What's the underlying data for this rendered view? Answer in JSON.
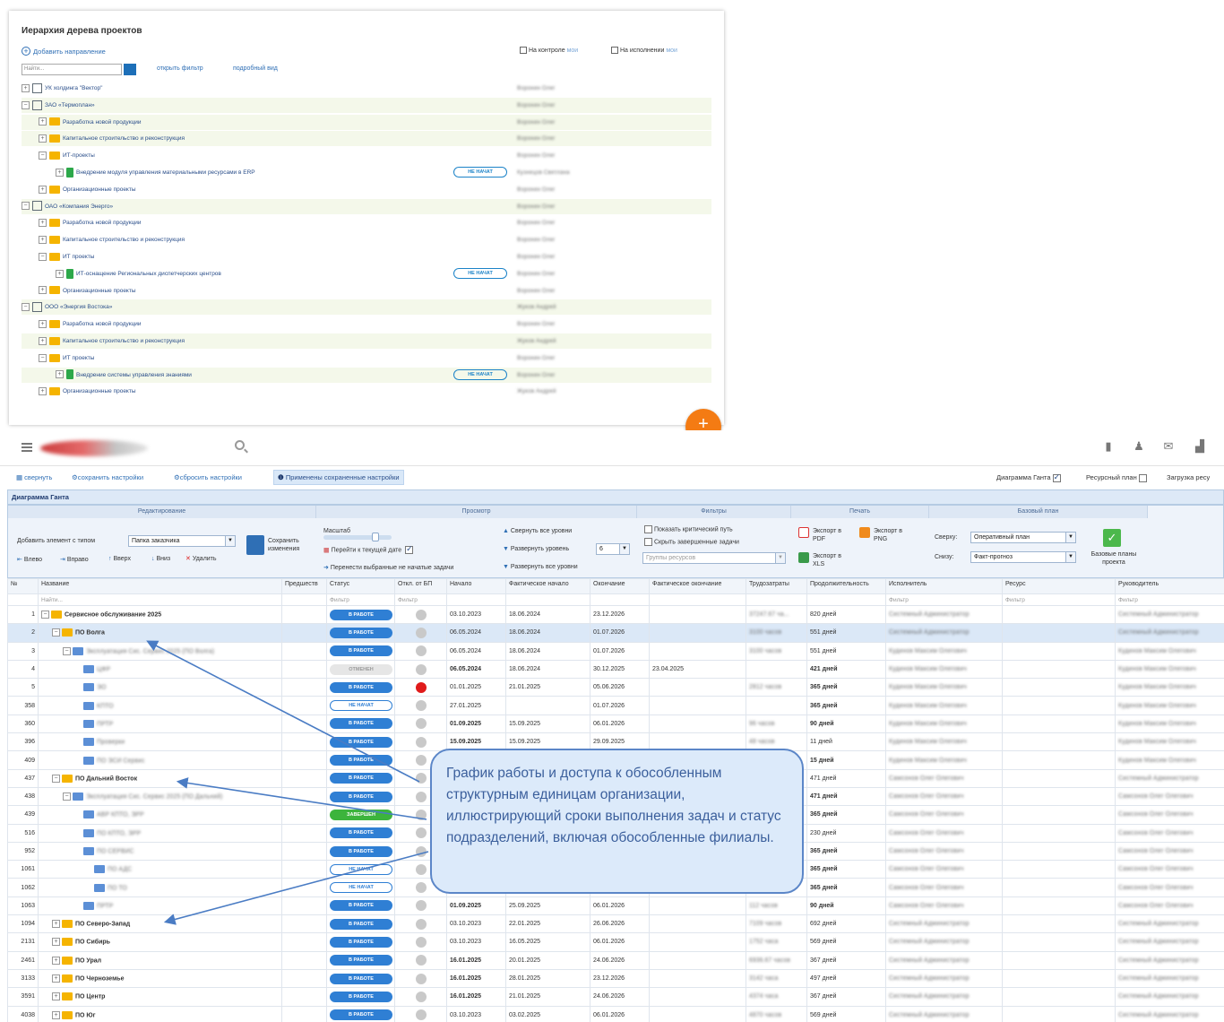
{
  "top_panel": {
    "title": "Иерархия дерева проектов",
    "add_direction": "Добавить направление",
    "search_placeholder": "Найти...",
    "open_filter": "открыть фильтр",
    "detail_view": "подробный вид",
    "on_control_label": "На контроле",
    "on_execution_label": "На исполнении",
    "mine_label": "мои",
    "not_started": "НЕ НАЧАТ",
    "fab_plus": "+",
    "tree": [
      {
        "level": 0,
        "icon": "building",
        "name": "УК холдинга \"Вектор\"",
        "resp": "Воронин Олег",
        "band": false,
        "expander": "+"
      },
      {
        "level": 0,
        "icon": "building",
        "name": "ЗАО «Термоплан»",
        "resp": "Воронин Олег",
        "band": true,
        "expander": "−"
      },
      {
        "level": 1,
        "icon": "folder",
        "name": "Разработка новой продукции",
        "resp": "Воронин Олег",
        "band": true,
        "expander": "+"
      },
      {
        "level": 1,
        "icon": "folder",
        "name": "Капитальное строительство и реконструкция",
        "resp": "Воронин Олег",
        "band": true,
        "expander": "+"
      },
      {
        "level": 1,
        "icon": "folder",
        "name": "ИТ-проекты",
        "resp": "Воронин Олег",
        "band": false,
        "expander": "−"
      },
      {
        "level": 2,
        "icon": "green",
        "name": "Внедрение модуля управления материальными ресурсами в ERP",
        "resp": "Кузнецов Светлана",
        "band": false,
        "expander": "+",
        "badge": true
      },
      {
        "level": 1,
        "icon": "folder",
        "name": "Организационные проекты",
        "resp": "Воронин Олег",
        "band": false,
        "expander": "+"
      },
      {
        "level": 0,
        "icon": "building",
        "name": "ОАО «Компания Энерго»",
        "resp": "Воронин Олег",
        "band": true,
        "expander": "−"
      },
      {
        "level": 1,
        "icon": "folder",
        "name": "Разработка новой продукции",
        "resp": "Воронин Олег",
        "band": false,
        "expander": "+"
      },
      {
        "level": 1,
        "icon": "folder",
        "name": "Капитальное строительство и реконструкция",
        "resp": "Воронин Олег",
        "band": false,
        "expander": "+"
      },
      {
        "level": 1,
        "icon": "folder",
        "name": "ИТ проекты",
        "resp": "Воронин Олег",
        "band": false,
        "expander": "−"
      },
      {
        "level": 2,
        "icon": "green",
        "name": "ИТ-оснащение Региональных диспетчерских центров",
        "resp": "Воронин Олег",
        "band": false,
        "expander": "+",
        "badge": true
      },
      {
        "level": 1,
        "icon": "folder",
        "name": "Организационные проекты",
        "resp": "Воронин Олег",
        "band": false,
        "expander": "+"
      },
      {
        "level": 0,
        "icon": "building",
        "name": "ООО «Энергия Востока»",
        "resp": "Жуков Андрей",
        "band": true,
        "expander": "−"
      },
      {
        "level": 1,
        "icon": "folder",
        "name": "Разработка новой продукции",
        "resp": "Воронин Олег",
        "band": false,
        "expander": "+"
      },
      {
        "level": 1,
        "icon": "folder",
        "name": "Капитальное строительство и реконструкция",
        "resp": "Жуков Андрей",
        "band": true,
        "expander": "+"
      },
      {
        "level": 1,
        "icon": "folder",
        "name": "ИТ проекты",
        "resp": "Воронин Олег",
        "band": false,
        "expander": "−"
      },
      {
        "level": 2,
        "icon": "green",
        "name": "Внедрение системы управления знаниями",
        "resp": "Воронин Олег",
        "band": true,
        "expander": "+",
        "badge": true
      },
      {
        "level": 1,
        "icon": "folder",
        "name": "Организационные проекты",
        "resp": "Жуков Андрей",
        "band": false,
        "expander": "+"
      }
    ]
  },
  "settings_bar": {
    "collapse": "свернуть",
    "save_settings": "сохранить настройки",
    "reset_settings": "сбросить настройки",
    "applied": "Применены сохраненные настройки",
    "gantt_label": "Диаграмма Ганта",
    "resource_label": "Ресурсный план",
    "load_label": "Загрузка ресу"
  },
  "ribbon": {
    "title": "Диаграмма Ганта",
    "groups": {
      "edit": "Редактирование",
      "view": "Просмотр",
      "filters": "Фильтры",
      "print": "Печать",
      "baseline": "Базовый план"
    },
    "add_element_label": "Добавить элемент с типом",
    "element_type": "Папка заказчика",
    "save_changes": "Сохранить изменения",
    "left": "Влево",
    "right": "Вправо",
    "up": "Вверх",
    "down": "Вниз",
    "delete": "Удалить",
    "scale": "Масштаб",
    "goto_date": "Перейти к текущей дате",
    "move_unstarted": "Перенести выбранные не начатые задачи",
    "collapse_all": "Свернуть все уровни",
    "expand_levels": "Развернуть уровень",
    "expand_level_value": "6",
    "expand_all": "Развернуть все уровни",
    "show_critical": "Показать критический путь",
    "hide_completed": "Скрыть завершенные задачи",
    "resource_groups": "Группы ресурсов",
    "export_pdf": "Экспорт в PDF",
    "export_png": "Экспорт в PNG",
    "export_xls": "Экспорт в XLS",
    "top_label": "Сверху:",
    "top_value": "Оперативный план",
    "bottom_label": "Снизу:",
    "bottom_value": "Факт-прогноз",
    "baseline_btn": "Базовые планы проекта"
  },
  "grid": {
    "headers": [
      "№",
      "Название",
      "Предшеств",
      "Статус",
      "Откл. от БП",
      "Начало",
      "Фактическое начало",
      "Окончание",
      "Фактическое окончание",
      "Трудозатраты",
      "Продолжительность",
      "Исполнитель",
      "Ресурс",
      "Руководитель"
    ],
    "filter_find": "Найти...",
    "filter": "Фильтр",
    "rows": [
      {
        "n": "1",
        "name": "Сервисное обслуживание 2025",
        "lvl": 0,
        "icon": "folder",
        "bold": true,
        "exp": "−",
        "status": "work",
        "dot": "gray",
        "start": "03.10.2023",
        "fstart": "18.06.2024",
        "end": "23.12.2026",
        "fend": "",
        "labor": "37247.67 ча...",
        "dur": "820 дней",
        "durb": false,
        "exec": "Системный Администратор",
        "mgr": "Системный Администратор",
        "sb": false
      },
      {
        "n": "2",
        "name": "ПО Волга",
        "lvl": 1,
        "icon": "folder",
        "bold": true,
        "exp": "−",
        "status": "work",
        "dot": "gray",
        "start": "06.05.2024",
        "fstart": "18.06.2024",
        "end": "01.07.2026",
        "fend": "",
        "labor": "3100 часов",
        "dur": "551 дней",
        "durb": false,
        "exec": "Системный Администратор",
        "mgr": "Системный Администратор",
        "sel": true,
        "sb": false
      },
      {
        "n": "3",
        "name": "Эксплуатация Сис. Сервис 2025 (ПО Волга)",
        "lvl": 2,
        "icon": "file",
        "bold": false,
        "blur": true,
        "exp": "−",
        "status": "work",
        "dot": "gray",
        "start": "06.05.2024",
        "fstart": "18.06.2024",
        "end": "01.07.2026",
        "fend": "",
        "labor": "3100 часов",
        "dur": "551 дней",
        "durb": false,
        "exec": "Кудинов Максим Олегович",
        "mgr": "Кудинов Максим Олегович",
        "sb": false
      },
      {
        "n": "4",
        "name": "ЦФР",
        "lvl": 3,
        "icon": "file",
        "bold": false,
        "blur": true,
        "exp": "",
        "status": "cancel",
        "dot": "gray",
        "start": "06.05.2024",
        "fstart": "18.06.2024",
        "end": "30.12.2025",
        "fend": "23.04.2025",
        "labor": "",
        "dur": "421 дней",
        "durb": true,
        "exec": "Кудинов Максим Олегович",
        "mgr": "Кудинов Максим Олегович",
        "sb": true
      },
      {
        "n": "5",
        "name": "ЭО",
        "lvl": 3,
        "icon": "file",
        "bold": false,
        "blur": true,
        "exp": "",
        "status": "work",
        "dot": "red",
        "start": "01.01.2025",
        "fstart": "21.01.2025",
        "end": "05.06.2026",
        "fend": "",
        "labor": "2812 часов",
        "dur": "365 дней",
        "durb": true,
        "exec": "Кудинов Максим Олегович",
        "mgr": "Кудинов Максим Олегович",
        "sb": false
      },
      {
        "n": "358",
        "name": "КПТО",
        "lvl": 3,
        "icon": "file",
        "bold": false,
        "blur": true,
        "exp": "",
        "status": "new",
        "dot": "gray",
        "start": "27.01.2025",
        "fstart": "",
        "end": "01.07.2026",
        "fend": "",
        "labor": "",
        "dur": "365 дней",
        "durb": true,
        "exec": "Кудинов Максим Олегович",
        "mgr": "Кудинов Максим Олегович",
        "sb": false
      },
      {
        "n": "360",
        "name": "ПРТР",
        "lvl": 3,
        "icon": "file",
        "bold": false,
        "blur": true,
        "exp": "",
        "status": "work",
        "dot": "gray",
        "start": "01.09.2025",
        "fstart": "15.09.2025",
        "end": "06.01.2026",
        "fend": "",
        "labor": "96 часов",
        "dur": "90 дней",
        "durb": true,
        "exec": "Кудинов Максим Олегович",
        "mgr": "Кудинов Максим Олегович",
        "sb": true
      },
      {
        "n": "396",
        "name": "Проверки",
        "lvl": 3,
        "icon": "file",
        "bold": false,
        "blur": true,
        "exp": "",
        "status": "work",
        "dot": "gray",
        "start": "15.09.2025",
        "fstart": "15.09.2025",
        "end": "29.09.2025",
        "fend": "",
        "labor": "48 часов",
        "dur": "11 дней",
        "durb": false,
        "exec": "Кудинов Максим Олегович",
        "mgr": "Кудинов Максим Олегович",
        "sb": true
      },
      {
        "n": "409",
        "name": "ПО ЭСИ Сервис",
        "lvl": 3,
        "icon": "file",
        "bold": false,
        "blur": true,
        "exp": "",
        "status": "work",
        "dot": "gray",
        "start": "",
        "fstart": "",
        "end": "",
        "fend": "",
        "labor": "",
        "dur": "15 дней",
        "durb": true,
        "exec": "Кудинов Максим Олегович",
        "mgr": "Кудинов Максим Олегович",
        "sb": false
      },
      {
        "n": "437",
        "name": "ПО Дальний Восток",
        "lvl": 1,
        "icon": "folder",
        "bold": true,
        "exp": "−",
        "status": "work",
        "dot": "gray",
        "start": "",
        "fstart": "",
        "end": "",
        "fend": "",
        "labor": "",
        "dur": "471 дней",
        "durb": false,
        "exec": "Самсонов Олег Олегович",
        "mgr": "Системный Администратор",
        "sb": false
      },
      {
        "n": "438",
        "name": "Эксплуатация Сис. Сервис 2025 (ПО Дальний)",
        "lvl": 2,
        "icon": "file",
        "bold": false,
        "blur": true,
        "exp": "−",
        "status": "work",
        "dot": "gray",
        "start": "",
        "fstart": "",
        "end": "",
        "fend": "",
        "labor": "",
        "dur": "471 дней",
        "durb": true,
        "exec": "Самсонов Олег Олегович",
        "mgr": "Самсонов Олег Олегович",
        "sb": false
      },
      {
        "n": "439",
        "name": "АВР КПТО, ЭРР",
        "lvl": 3,
        "icon": "file",
        "bold": false,
        "blur": true,
        "exp": "",
        "status": "done",
        "dot": "gray",
        "start": "",
        "fstart": "",
        "end": "",
        "fend": "",
        "labor": "",
        "dur": "365 дней",
        "durb": true,
        "exec": "Самсонов Олег Олегович",
        "mgr": "Самсонов Олег Олегович",
        "sb": false
      },
      {
        "n": "516",
        "name": "ПО КПТО, ЭРР",
        "lvl": 3,
        "icon": "file",
        "bold": false,
        "blur": true,
        "exp": "",
        "status": "work",
        "dot": "gray",
        "start": "",
        "fstart": "",
        "end": "",
        "fend": "",
        "labor": "",
        "dur": "230 дней",
        "durb": false,
        "exec": "Самсонов Олег Олегович",
        "mgr": "Самсонов Олег Олегович",
        "sb": false
      },
      {
        "n": "952",
        "name": "ПО СЕРВИС",
        "lvl": 3,
        "icon": "file",
        "bold": false,
        "blur": true,
        "exp": "",
        "status": "work",
        "dot": "gray",
        "start": "",
        "fstart": "",
        "end": "",
        "fend": "",
        "labor": "",
        "dur": "365 дней",
        "durb": true,
        "exec": "Самсонов Олег Олегович",
        "mgr": "Самсонов Олег Олегович",
        "sb": false
      },
      {
        "n": "1061",
        "name": "ПО АДС",
        "lvl": 4,
        "icon": "file",
        "bold": false,
        "blur": true,
        "exp": "",
        "status": "new",
        "dot": "gray",
        "start": "",
        "fstart": "",
        "end": "",
        "fend": "",
        "labor": "",
        "dur": "365 дней",
        "durb": true,
        "exec": "Самсонов Олег Олегович",
        "mgr": "Самсонов Олег Олегович",
        "sb": false
      },
      {
        "n": "1062",
        "name": "ПО ТО",
        "lvl": 4,
        "icon": "file",
        "bold": false,
        "blur": true,
        "exp": "",
        "status": "new",
        "dot": "gray",
        "start": "",
        "fstart": "",
        "end": "",
        "fend": "",
        "labor": "",
        "dur": "365 дней",
        "durb": true,
        "exec": "Самсонов Олег Олегович",
        "mgr": "Самсонов Олег Олегович",
        "sb": false
      },
      {
        "n": "1063",
        "name": "ПРТР",
        "lvl": 3,
        "icon": "file",
        "bold": false,
        "blur": true,
        "exp": "",
        "status": "work",
        "dot": "gray",
        "start": "01.09.2025",
        "fstart": "25.09.2025",
        "end": "06.01.2026",
        "fend": "",
        "labor": "112 часов",
        "dur": "90 дней",
        "durb": true,
        "exec": "Самсонов Олег Олегович",
        "mgr": "Самсонов Олег Олегович",
        "sb": true
      },
      {
        "n": "1094",
        "name": "ПО Северо-Запад",
        "lvl": 1,
        "icon": "folder",
        "bold": true,
        "exp": "+",
        "status": "work",
        "dot": "gray",
        "start": "03.10.2023",
        "fstart": "22.01.2025",
        "end": "26.06.2026",
        "fend": "",
        "labor": "7109 часов",
        "dur": "692 дней",
        "durb": false,
        "exec": "Системный Администратор",
        "mgr": "Системный Администратор",
        "sb": false
      },
      {
        "n": "2131",
        "name": "ПО Сибирь",
        "lvl": 1,
        "icon": "folder",
        "bold": true,
        "exp": "+",
        "status": "work",
        "dot": "gray",
        "start": "03.10.2023",
        "fstart": "16.05.2025",
        "end": "06.01.2026",
        "fend": "",
        "labor": "1752 часа",
        "dur": "569 дней",
        "durb": false,
        "exec": "Системный Администратор",
        "mgr": "Системный Администратор",
        "sb": false
      },
      {
        "n": "2461",
        "name": "ПО Урал",
        "lvl": 1,
        "icon": "folder",
        "bold": true,
        "exp": "+",
        "status": "work",
        "dot": "gray",
        "start": "16.01.2025",
        "fstart": "20.01.2025",
        "end": "24.06.2026",
        "fend": "",
        "labor": "6936.67 часов",
        "dur": "367 дней",
        "durb": false,
        "exec": "Системный Администратор",
        "mgr": "Системный Администратор",
        "sb": true
      },
      {
        "n": "3133",
        "name": "ПО Черноземье",
        "lvl": 1,
        "icon": "folder",
        "bold": true,
        "exp": "+",
        "status": "work",
        "dot": "gray",
        "start": "16.01.2025",
        "fstart": "28.01.2025",
        "end": "23.12.2026",
        "fend": "",
        "labor": "3142 часа",
        "dur": "497 дней",
        "durb": false,
        "exec": "Системный Администратор",
        "mgr": "Системный Администратор",
        "sb": true
      },
      {
        "n": "3591",
        "name": "ПО Центр",
        "lvl": 1,
        "icon": "folder",
        "bold": true,
        "exp": "+",
        "status": "work",
        "dot": "gray",
        "start": "16.01.2025",
        "fstart": "21.01.2025",
        "end": "24.06.2026",
        "fend": "",
        "labor": "4374 часа",
        "dur": "367 дней",
        "durb": false,
        "exec": "Системный Администратор",
        "mgr": "Системный Администратор",
        "sb": true
      },
      {
        "n": "4038",
        "name": "ПО Юг",
        "lvl": 1,
        "icon": "folder",
        "bold": true,
        "exp": "+",
        "status": "work",
        "dot": "gray",
        "start": "03.10.2023",
        "fstart": "03.02.2025",
        "end": "06.01.2026",
        "fend": "",
        "labor": "4870 часов",
        "dur": "569 дней",
        "durb": false,
        "exec": "Системный Администратор",
        "mgr": "Системный Администратор",
        "sb": false
      }
    ],
    "status_labels": {
      "work": "В РАБОТЕ",
      "cancel": "ОТМЕНЕН",
      "new": "НЕ НАЧАТ",
      "done": "ЗАВЕРШЕН"
    }
  },
  "callout": "График работы и доступа к обособленным структурным единицам организации, иллюстрирующий сроки выполнения задач и статус подразделений, включая обособленные филиалы.",
  "colors": {
    "accent": "#2f7fd4",
    "fab": "#f47b13",
    "arrow": "#4a7cc4"
  }
}
